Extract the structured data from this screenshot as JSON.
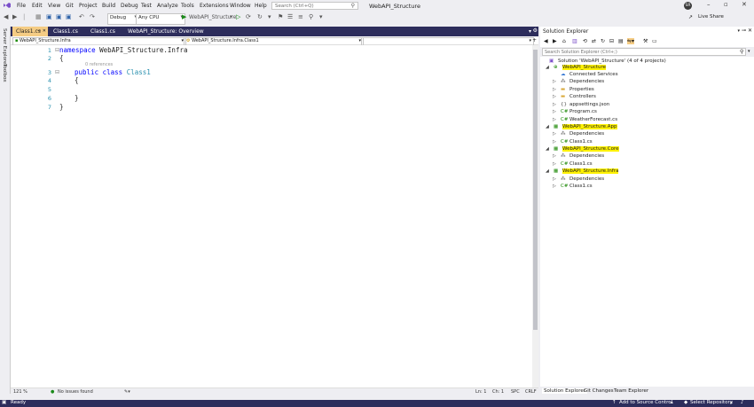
{
  "menubar": {
    "items": [
      "File",
      "Edit",
      "View",
      "Git",
      "Project",
      "Build",
      "Debug",
      "Test",
      "Analyze",
      "Tools",
      "Extensions",
      "Window",
      "Help"
    ],
    "search_placeholder": "Search (Ctrl+Q)",
    "window_title": "WebAPI_Structure",
    "avatar_initials": "SR"
  },
  "toolbar": {
    "config": "Debug",
    "platform": "Any CPU",
    "run_target": "WebAPI_Structure",
    "live_share": "Live Share"
  },
  "side_strip": {
    "server_explorer": "Server Explorer",
    "toolbox": "Toolbox"
  },
  "tabs": [
    {
      "label": "Class1.cs",
      "active": true
    },
    {
      "label": "Class1.cs",
      "active": false
    },
    {
      "label": "Class1.cs",
      "active": false
    },
    {
      "label": "WebAPI_Structure: Overview",
      "active": false
    }
  ],
  "navbar": {
    "project": "WebAPI_Structure.Infra",
    "type": "WebAPI_Structure.Infra.Class1"
  },
  "editor": {
    "line_numbers": [
      "1",
      "2",
      "3",
      "4",
      "5",
      "6",
      "7"
    ],
    "references_hint": "0 references",
    "namespace_keyword": "namespace",
    "namespace_name": "WebAPI_Structure.Infra",
    "open_brace": "{",
    "class_keywords": "public class",
    "class_name": "Class1",
    "inner_open": "{",
    "inner_close": "}",
    "close_brace": "}"
  },
  "status_line": {
    "zoom": "121 %",
    "issues": "No issues found",
    "line": "Ln: 1",
    "col": "Ch: 1",
    "spc": "SPC",
    "eol": "CRLF"
  },
  "solution_explorer": {
    "title": "Solution Explorer",
    "search_placeholder": "Search Solution Explorer (Ctrl+;)",
    "tree": [
      {
        "label": "Solution 'WebAPI_Structure' (4 of 4 projects)",
        "level": 0,
        "icon": "solution",
        "expander": "",
        "highlight": false
      },
      {
        "label": "WebAPI_Structure",
        "level": 1,
        "icon": "web-project",
        "expander": "open",
        "highlight": true
      },
      {
        "label": "Connected Services",
        "level": 2,
        "icon": "services",
        "expander": "",
        "highlight": false
      },
      {
        "label": "Dependencies",
        "level": 2,
        "icon": "dependencies",
        "expander": "closed",
        "highlight": false
      },
      {
        "label": "Properties",
        "level": 2,
        "icon": "folder",
        "expander": "closed",
        "highlight": false
      },
      {
        "label": "Controllers",
        "level": 2,
        "icon": "folder",
        "expander": "closed",
        "highlight": false
      },
      {
        "label": "appsettings.json",
        "level": 2,
        "icon": "json",
        "expander": "closed",
        "highlight": false
      },
      {
        "label": "Program.cs",
        "level": 2,
        "icon": "csharp",
        "expander": "closed",
        "highlight": false
      },
      {
        "label": "WeatherForecast.cs",
        "level": 2,
        "icon": "csharp",
        "expander": "closed",
        "highlight": false
      },
      {
        "label": "WebAPI_Structure.App",
        "level": 1,
        "icon": "lib-project",
        "expander": "open",
        "highlight": true
      },
      {
        "label": "Dependencies",
        "level": 2,
        "icon": "dependencies",
        "expander": "closed",
        "highlight": false
      },
      {
        "label": "Class1.cs",
        "level": 2,
        "icon": "csharp",
        "expander": "closed",
        "highlight": false
      },
      {
        "label": "WebAPI_Structure.Core",
        "level": 1,
        "icon": "lib-project",
        "expander": "open",
        "highlight": true
      },
      {
        "label": "Dependencies",
        "level": 2,
        "icon": "dependencies",
        "expander": "closed",
        "highlight": false
      },
      {
        "label": "Class1.cs",
        "level": 2,
        "icon": "csharp",
        "expander": "closed",
        "highlight": false
      },
      {
        "label": "WebAPI_Structure.Infra",
        "level": 1,
        "icon": "lib-project",
        "expander": "open",
        "highlight": true
      },
      {
        "label": "Dependencies",
        "level": 2,
        "icon": "dependencies",
        "expander": "closed",
        "highlight": false
      },
      {
        "label": "Class1.cs",
        "level": 2,
        "icon": "csharp",
        "expander": "closed",
        "highlight": false
      }
    ],
    "bottom_tabs": [
      "Solution Explorer",
      "Git Changes",
      "Team Explorer"
    ]
  },
  "statusbar": {
    "ready": "Ready",
    "source_control": "Add to Source Control",
    "repository": "Select Repository"
  },
  "colors": {
    "accent": "#2d2d5c",
    "active_tab": "#f5cc84",
    "highlight": "#fff200",
    "keyword": "#0000ff",
    "type": "#2b91af"
  }
}
